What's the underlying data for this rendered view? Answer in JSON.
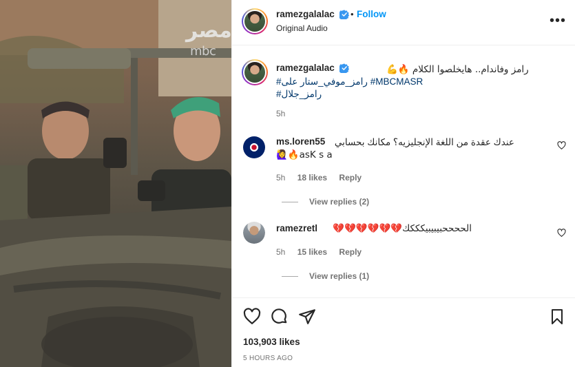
{
  "header": {
    "username": "ramezgalalac",
    "dot": "•",
    "follow_label": "Follow",
    "audio": "Original Audio",
    "more": "•••"
  },
  "media": {
    "watermark_text": "مصر",
    "watermark_brand": "mbc"
  },
  "caption": {
    "username": "ramezgalalac",
    "line1": "رامز وفاندام.. هايخلصوا الكلام 🔥💪",
    "tag_masr": "#MBCMASR",
    "tag_on": "#رامز_موفي_ستار على",
    "tag_ramez": "#رامز_جلال",
    "time": "5h"
  },
  "comments": [
    {
      "username": "ms.loren55",
      "text": "عندك عقدة من اللغة الإنجليزيه؟ مكانك بحسابي",
      "text2": "🙋‍♀️🔥asK s a",
      "time": "5h",
      "likes": "18 likes",
      "reply": "Reply",
      "view_replies": "View replies (2)"
    },
    {
      "username": "ramezretl",
      "text": "الححححبيبيبيكككك💔💔💔💔💔💔",
      "time": "5h",
      "likes": "15 likes",
      "reply": "Reply",
      "view_replies": "View replies (1)"
    }
  ],
  "footer": {
    "likes": "103,903 likes",
    "ago": "5 HOURS AGO"
  },
  "icons": [
    "verified-badge-icon",
    "more-options-icon",
    "heart-icon",
    "comment-icon",
    "share-icon",
    "bookmark-icon"
  ],
  "colors": {
    "link": "#0095f6",
    "hashtag": "#00376b",
    "muted": "#737373",
    "verified": "#3897f0"
  }
}
